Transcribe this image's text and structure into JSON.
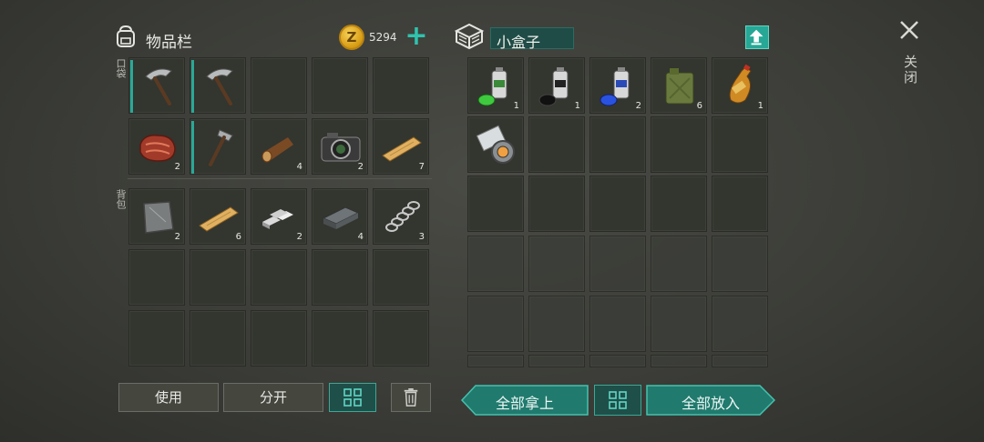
{
  "inventory": {
    "title": "物品栏",
    "pocket_label": "口袋",
    "backpack_label": "背包",
    "currency_icon_letter": "Z",
    "coins": "5294",
    "add_coins_icon": "plus-icon",
    "pockets": [
      {
        "item": "pickaxe-icon",
        "count": "",
        "equipped": true
      },
      {
        "item": "pickaxe-icon",
        "count": "",
        "equipped": true
      },
      {
        "item": "",
        "count": ""
      },
      {
        "item": "",
        "count": ""
      },
      {
        "item": "",
        "count": ""
      },
      {
        "item": "steak-icon",
        "count": "2"
      },
      {
        "item": "hammer-icon",
        "count": "",
        "equipped": true
      },
      {
        "item": "log-icon",
        "count": "4"
      },
      {
        "item": "camera-icon",
        "count": "2"
      },
      {
        "item": "plank-icon",
        "count": "7"
      }
    ],
    "backpack": [
      {
        "item": "metal-scrap-icon",
        "count": "2"
      },
      {
        "item": "plank-icon",
        "count": "6"
      },
      {
        "item": "aluminum-ingots-icon",
        "count": "2"
      },
      {
        "item": "iron-ingot-icon",
        "count": "4"
      },
      {
        "item": "spring-icon",
        "count": "3"
      },
      {
        "item": "",
        "count": ""
      },
      {
        "item": "",
        "count": ""
      },
      {
        "item": "",
        "count": ""
      },
      {
        "item": "",
        "count": ""
      },
      {
        "item": "",
        "count": ""
      },
      {
        "item": "",
        "count": ""
      },
      {
        "item": "",
        "count": ""
      },
      {
        "item": "",
        "count": ""
      },
      {
        "item": "",
        "count": ""
      },
      {
        "item": "",
        "count": ""
      }
    ],
    "buttons": {
      "use": "使用",
      "split": "分开",
      "sort_icon": "grid-icon",
      "delete_icon": "trash-icon"
    }
  },
  "container": {
    "name": "小盒子",
    "box_icon": "box-icon",
    "upload_icon": "upload-icon",
    "slots": [
      {
        "item": "green-spray-paint-icon",
        "count": "1"
      },
      {
        "item": "black-spray-paint-icon",
        "count": "1"
      },
      {
        "item": "blue-spray-paint-icon",
        "count": "2"
      },
      {
        "item": "jerrycan-icon",
        "count": "6"
      },
      {
        "item": "soda-bottle-icon",
        "count": "1"
      },
      {
        "item": "duct-tape-icon",
        "count": ""
      }
    ],
    "buttons": {
      "take_all": "全部拿上",
      "sort_icon": "grid-icon",
      "put_all": "全部放入"
    }
  },
  "close": {
    "icon": "close-icon",
    "label": "关闭"
  },
  "colors": {
    "accent": "#2aa897",
    "slot": "#33352f",
    "background": "#3c3d38"
  }
}
